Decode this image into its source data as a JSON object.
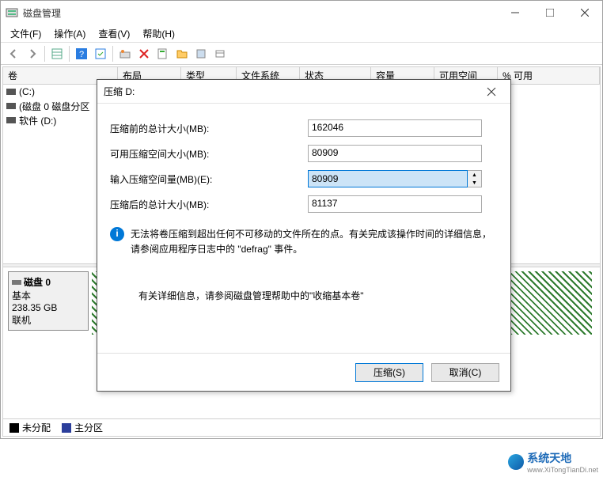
{
  "titlebar": {
    "title": "磁盘管理"
  },
  "menubar": {
    "file": "文件(F)",
    "action": "操作(A)",
    "view": "查看(V)",
    "help": "帮助(H)"
  },
  "columns": {
    "volume": "卷",
    "layout": "布局",
    "type": "类型",
    "fs": "文件系统",
    "status": "状态",
    "capacity": "容量",
    "free": "可用空间",
    "pctfree": "% 可用"
  },
  "volumes": {
    "c": "(C:)",
    "disk0part": "(磁盘 0 磁盘分区",
    "soft": "软件 (D:)"
  },
  "diskblock": {
    "name": "磁盘 0",
    "basic": "基本",
    "size": "238.35 GB",
    "status": "联机"
  },
  "legend": {
    "unalloc": "未分配",
    "primary": "主分区"
  },
  "dialog": {
    "title": "压缩 D:",
    "row_total_before": "压缩前的总计大小(MB):",
    "val_total_before": "162046",
    "row_avail": "可用压缩空间大小(MB):",
    "val_avail": "80909",
    "row_input": "输入压缩空间量(MB)(E):",
    "val_input": "80909",
    "row_total_after": "压缩后的总计大小(MB):",
    "val_total_after": "81137",
    "info1": "无法将卷压缩到超出任何不可移动的文件所在的点。有关完成该操作时间的详细信息，请参阅应用程序日志中的 \"defrag\" 事件。",
    "info2": "有关详细信息，请参阅磁盘管理帮助中的\"收缩基本卷\"",
    "btn_shrink": "压缩(S)",
    "btn_cancel": "取消(C)"
  },
  "watermark": {
    "cn": "系统天地",
    "en": "www.XiTongTianDi.net"
  }
}
